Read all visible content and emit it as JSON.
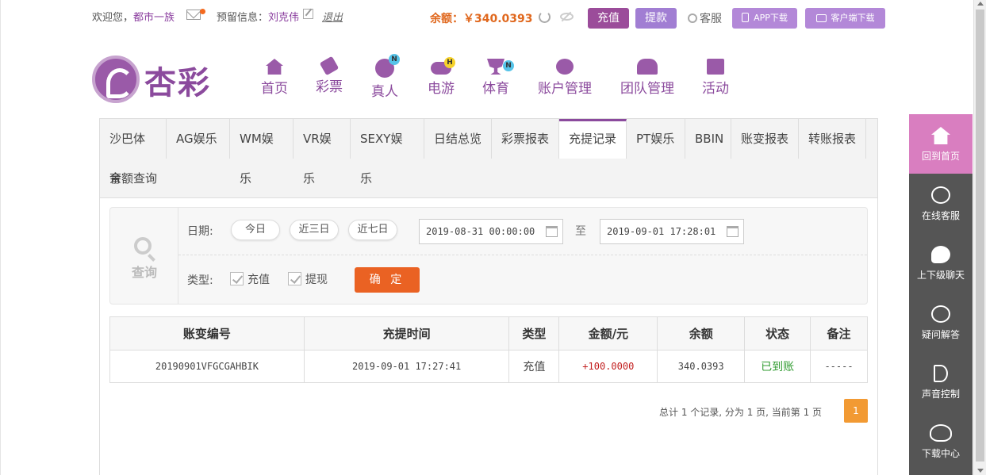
{
  "topbar": {
    "welcome_prefix": "欢迎您，",
    "username": "都市一族",
    "reserve_label": "预留信息：",
    "reserve_name": "刘克伟",
    "logout": "退出",
    "balance": "余额：￥340.0393",
    "recharge": "充值",
    "withdraw": "提款",
    "customer_service": "客服",
    "app_download": "APP下载",
    "client_download": "客户端下载"
  },
  "logo": {
    "text": "杏彩"
  },
  "nav": [
    {
      "label": "首页",
      "icon": "home-icon",
      "badge": ""
    },
    {
      "label": "彩票",
      "icon": "ticket-icon",
      "badge": ""
    },
    {
      "label": "真人",
      "icon": "dealer-icon",
      "badge": "N"
    },
    {
      "label": "电游",
      "icon": "gamepad-icon",
      "badge": "H"
    },
    {
      "label": "体育",
      "icon": "trophy-icon",
      "badge": "N"
    },
    {
      "label": "账户管理",
      "icon": "yen-coin-icon",
      "badge": ""
    },
    {
      "label": "团队管理",
      "icon": "team-icon",
      "badge": ""
    },
    {
      "label": "活动",
      "icon": "gift-icon",
      "badge": ""
    }
  ],
  "tabs": [
    "沙巴体育",
    "AG娱乐",
    "WM娱乐",
    "VR娱乐",
    "SEXY娱乐",
    "日结总览",
    "彩票报表",
    "充提记录",
    "PT娱乐",
    "BBIN",
    "账变报表",
    "转账报表",
    "余额查询"
  ],
  "active_tab": "充提记录",
  "search": {
    "side_label": "查询",
    "date_label": "日期:",
    "quick": [
      "今日",
      "近三日",
      "近七日"
    ],
    "start": "2019-08-31 00:00:00",
    "to": "至",
    "end": "2019-09-01 17:28:01",
    "type_label": "类型:",
    "types": [
      "充值",
      "提现"
    ],
    "confirm": "确 定"
  },
  "table": {
    "headers": [
      "账变编号",
      "充提时间",
      "类型",
      "金额/元",
      "余额",
      "状态",
      "备注"
    ],
    "rows": [
      [
        "20190901VFGCGAHBIK",
        "2019-09-01 17:27:41",
        "充值",
        "+100.0000",
        "340.0393",
        "已到账",
        "-----"
      ]
    ]
  },
  "pager": {
    "summary": "总计 1 个记录, 分为 1 页, 当前第 1 页",
    "current": "1"
  },
  "sidebar": [
    {
      "label": "回到首页",
      "icon": "home-icon"
    },
    {
      "label": "在线客服",
      "icon": "headset-24-icon"
    },
    {
      "label": "上下级聊天",
      "icon": "chat-icon"
    },
    {
      "label": "疑问解答",
      "icon": "question-icon"
    },
    {
      "label": "声音控制",
      "icon": "speaker-icon"
    },
    {
      "label": "下载中心",
      "icon": "cloud-download-icon"
    }
  ],
  "colors": {
    "brand": "#8b4a9d",
    "accent_orange": "#ea6223",
    "sidebar": "#555555",
    "sidebar_active": "#d97ec0"
  }
}
